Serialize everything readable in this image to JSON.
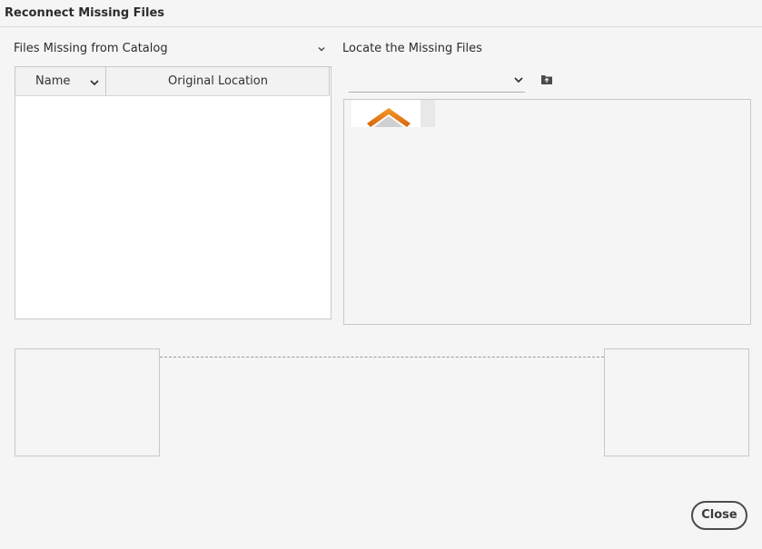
{
  "dialog": {
    "title": "Reconnect Missing Files"
  },
  "missing_files": {
    "heading": "Files Missing from Catalog",
    "columns": [
      "Name",
      "Original Location"
    ],
    "rows": []
  },
  "locate": {
    "heading": "Locate the Missing Files",
    "folder_select_value": ""
  },
  "icons": {
    "header_menu": "chevron-down-icon",
    "sort_name": "chevron-down-icon",
    "folder_dropdown": "chevron-down-icon",
    "browse": "folder-icon",
    "thumbnail": "folder-up-icon"
  },
  "colors": {
    "accent_orange": "#e8730c",
    "background": "#f5f5f5",
    "border": "#c8c8c8"
  },
  "buttons": {
    "close": "Close"
  }
}
